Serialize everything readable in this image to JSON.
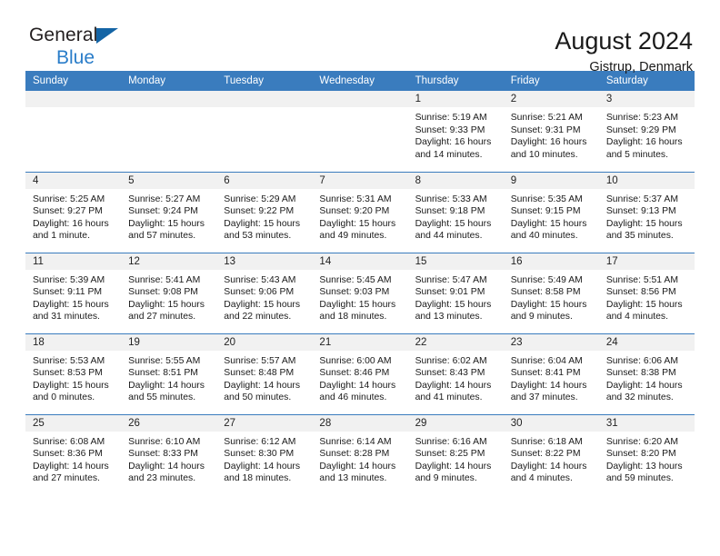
{
  "brand": {
    "name_top": "General",
    "name_bottom": "Blue",
    "triangle_color": "#1464a5",
    "blue_color": "#2a7dc9"
  },
  "header": {
    "title": "August 2024",
    "location": "Gistrup, Denmark"
  },
  "theme": {
    "header_bg": "#3a7cbe",
    "daynum_bg": "#f1f1f1",
    "row_border": "#3a7cbe"
  },
  "labels": {
    "sunrise_prefix": "Sunrise:",
    "sunset_prefix": "Sunset:",
    "daylight_prefix": "Daylight:"
  },
  "weekdays": [
    "Sunday",
    "Monday",
    "Tuesday",
    "Wednesday",
    "Thursday",
    "Friday",
    "Saturday"
  ],
  "weeks": [
    [
      {
        "day": "",
        "empty": true
      },
      {
        "day": "",
        "empty": true
      },
      {
        "day": "",
        "empty": true
      },
      {
        "day": "",
        "empty": true
      },
      {
        "day": "1",
        "sunrise": "Sunrise: 5:19 AM",
        "sunset": "Sunset: 9:33 PM",
        "daylight_l1": "Daylight: 16 hours",
        "daylight_l2": "and 14 minutes."
      },
      {
        "day": "2",
        "sunrise": "Sunrise: 5:21 AM",
        "sunset": "Sunset: 9:31 PM",
        "daylight_l1": "Daylight: 16 hours",
        "daylight_l2": "and 10 minutes."
      },
      {
        "day": "3",
        "sunrise": "Sunrise: 5:23 AM",
        "sunset": "Sunset: 9:29 PM",
        "daylight_l1": "Daylight: 16 hours",
        "daylight_l2": "and 5 minutes."
      }
    ],
    [
      {
        "day": "4",
        "sunrise": "Sunrise: 5:25 AM",
        "sunset": "Sunset: 9:27 PM",
        "daylight_l1": "Daylight: 16 hours",
        "daylight_l2": "and 1 minute."
      },
      {
        "day": "5",
        "sunrise": "Sunrise: 5:27 AM",
        "sunset": "Sunset: 9:24 PM",
        "daylight_l1": "Daylight: 15 hours",
        "daylight_l2": "and 57 minutes."
      },
      {
        "day": "6",
        "sunrise": "Sunrise: 5:29 AM",
        "sunset": "Sunset: 9:22 PM",
        "daylight_l1": "Daylight: 15 hours",
        "daylight_l2": "and 53 minutes."
      },
      {
        "day": "7",
        "sunrise": "Sunrise: 5:31 AM",
        "sunset": "Sunset: 9:20 PM",
        "daylight_l1": "Daylight: 15 hours",
        "daylight_l2": "and 49 minutes."
      },
      {
        "day": "8",
        "sunrise": "Sunrise: 5:33 AM",
        "sunset": "Sunset: 9:18 PM",
        "daylight_l1": "Daylight: 15 hours",
        "daylight_l2": "and 44 minutes."
      },
      {
        "day": "9",
        "sunrise": "Sunrise: 5:35 AM",
        "sunset": "Sunset: 9:15 PM",
        "daylight_l1": "Daylight: 15 hours",
        "daylight_l2": "and 40 minutes."
      },
      {
        "day": "10",
        "sunrise": "Sunrise: 5:37 AM",
        "sunset": "Sunset: 9:13 PM",
        "daylight_l1": "Daylight: 15 hours",
        "daylight_l2": "and 35 minutes."
      }
    ],
    [
      {
        "day": "11",
        "sunrise": "Sunrise: 5:39 AM",
        "sunset": "Sunset: 9:11 PM",
        "daylight_l1": "Daylight: 15 hours",
        "daylight_l2": "and 31 minutes."
      },
      {
        "day": "12",
        "sunrise": "Sunrise: 5:41 AM",
        "sunset": "Sunset: 9:08 PM",
        "daylight_l1": "Daylight: 15 hours",
        "daylight_l2": "and 27 minutes."
      },
      {
        "day": "13",
        "sunrise": "Sunrise: 5:43 AM",
        "sunset": "Sunset: 9:06 PM",
        "daylight_l1": "Daylight: 15 hours",
        "daylight_l2": "and 22 minutes."
      },
      {
        "day": "14",
        "sunrise": "Sunrise: 5:45 AM",
        "sunset": "Sunset: 9:03 PM",
        "daylight_l1": "Daylight: 15 hours",
        "daylight_l2": "and 18 minutes."
      },
      {
        "day": "15",
        "sunrise": "Sunrise: 5:47 AM",
        "sunset": "Sunset: 9:01 PM",
        "daylight_l1": "Daylight: 15 hours",
        "daylight_l2": "and 13 minutes."
      },
      {
        "day": "16",
        "sunrise": "Sunrise: 5:49 AM",
        "sunset": "Sunset: 8:58 PM",
        "daylight_l1": "Daylight: 15 hours",
        "daylight_l2": "and 9 minutes."
      },
      {
        "day": "17",
        "sunrise": "Sunrise: 5:51 AM",
        "sunset": "Sunset: 8:56 PM",
        "daylight_l1": "Daylight: 15 hours",
        "daylight_l2": "and 4 minutes."
      }
    ],
    [
      {
        "day": "18",
        "sunrise": "Sunrise: 5:53 AM",
        "sunset": "Sunset: 8:53 PM",
        "daylight_l1": "Daylight: 15 hours",
        "daylight_l2": "and 0 minutes."
      },
      {
        "day": "19",
        "sunrise": "Sunrise: 5:55 AM",
        "sunset": "Sunset: 8:51 PM",
        "daylight_l1": "Daylight: 14 hours",
        "daylight_l2": "and 55 minutes."
      },
      {
        "day": "20",
        "sunrise": "Sunrise: 5:57 AM",
        "sunset": "Sunset: 8:48 PM",
        "daylight_l1": "Daylight: 14 hours",
        "daylight_l2": "and 50 minutes."
      },
      {
        "day": "21",
        "sunrise": "Sunrise: 6:00 AM",
        "sunset": "Sunset: 8:46 PM",
        "daylight_l1": "Daylight: 14 hours",
        "daylight_l2": "and 46 minutes."
      },
      {
        "day": "22",
        "sunrise": "Sunrise: 6:02 AM",
        "sunset": "Sunset: 8:43 PM",
        "daylight_l1": "Daylight: 14 hours",
        "daylight_l2": "and 41 minutes."
      },
      {
        "day": "23",
        "sunrise": "Sunrise: 6:04 AM",
        "sunset": "Sunset: 8:41 PM",
        "daylight_l1": "Daylight: 14 hours",
        "daylight_l2": "and 37 minutes."
      },
      {
        "day": "24",
        "sunrise": "Sunrise: 6:06 AM",
        "sunset": "Sunset: 8:38 PM",
        "daylight_l1": "Daylight: 14 hours",
        "daylight_l2": "and 32 minutes."
      }
    ],
    [
      {
        "day": "25",
        "sunrise": "Sunrise: 6:08 AM",
        "sunset": "Sunset: 8:36 PM",
        "daylight_l1": "Daylight: 14 hours",
        "daylight_l2": "and 27 minutes."
      },
      {
        "day": "26",
        "sunrise": "Sunrise: 6:10 AM",
        "sunset": "Sunset: 8:33 PM",
        "daylight_l1": "Daylight: 14 hours",
        "daylight_l2": "and 23 minutes."
      },
      {
        "day": "27",
        "sunrise": "Sunrise: 6:12 AM",
        "sunset": "Sunset: 8:30 PM",
        "daylight_l1": "Daylight: 14 hours",
        "daylight_l2": "and 18 minutes."
      },
      {
        "day": "28",
        "sunrise": "Sunrise: 6:14 AM",
        "sunset": "Sunset: 8:28 PM",
        "daylight_l1": "Daylight: 14 hours",
        "daylight_l2": "and 13 minutes."
      },
      {
        "day": "29",
        "sunrise": "Sunrise: 6:16 AM",
        "sunset": "Sunset: 8:25 PM",
        "daylight_l1": "Daylight: 14 hours",
        "daylight_l2": "and 9 minutes."
      },
      {
        "day": "30",
        "sunrise": "Sunrise: 6:18 AM",
        "sunset": "Sunset: 8:22 PM",
        "daylight_l1": "Daylight: 14 hours",
        "daylight_l2": "and 4 minutes."
      },
      {
        "day": "31",
        "sunrise": "Sunrise: 6:20 AM",
        "sunset": "Sunset: 8:20 PM",
        "daylight_l1": "Daylight: 13 hours",
        "daylight_l2": "and 59 minutes."
      }
    ]
  ]
}
